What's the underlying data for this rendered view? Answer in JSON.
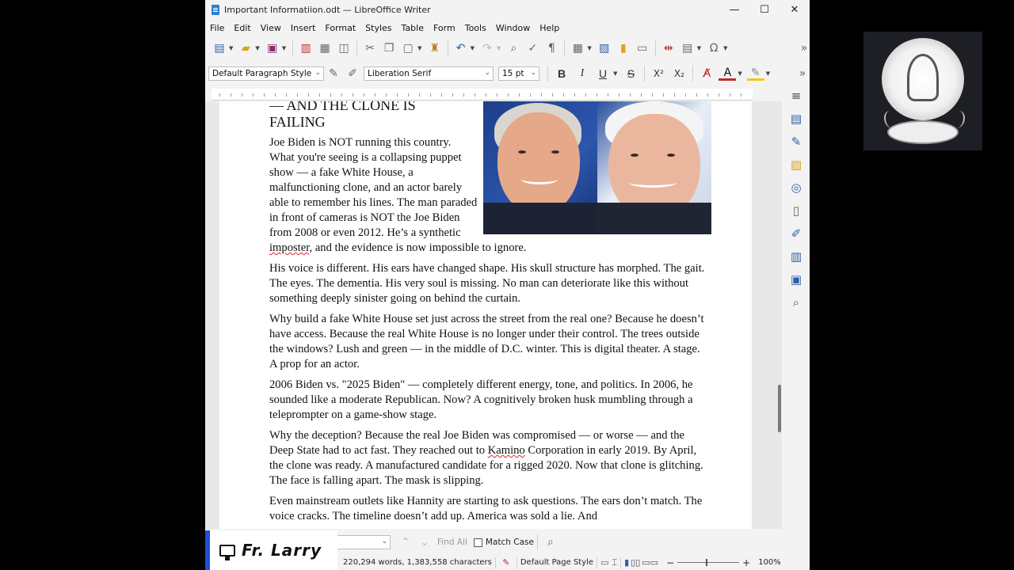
{
  "window": {
    "title": "Important Informatiion.odt — LibreOffice Writer",
    "minimize": "—",
    "maximize": "☐",
    "close": "✕"
  },
  "menu": [
    "File",
    "Edit",
    "View",
    "Insert",
    "Format",
    "Styles",
    "Table",
    "Form",
    "Tools",
    "Window",
    "Help"
  ],
  "formatting": {
    "paragraph_style": "Default Paragraph Style",
    "font_name": "Liberation Serif",
    "font_size": "15 pt",
    "bold": "B",
    "italic": "I",
    "underline": "U",
    "strike": "S",
    "superscript": "X²",
    "subscript": "X₂",
    "more": "»"
  },
  "document": {
    "heading_line1": "— AND THE CLONE IS",
    "heading_line2": "FAILING",
    "p1a": "Joe Biden is NOT running this country. What you're seeing is a collapsing puppet show — a fake White House, a malfunctioning clone, and an actor barely able to remember his lines. The man paraded in front of cameras is NOT the Joe Biden from 2008 or even 2012. He’s a synthetic ",
    "p1_misspelled": "imposter",
    "p1b": ", and the evidence is now impossible to ignore.",
    "p2": "His voice is different. His ears have changed shape. His skull structure has morphed. The gait. The eyes. The dementia. His very soul is missing. No man can deteriorate like this without something deeply sinister going on behind the curtain.",
    "p3": "Why build a fake White House set just across the street from the real one? Because he doesn’t have access. Because the real White House is no longer under their control. The trees outside the windows? Lush and green — in the middle of D.C. winter. This is digital theater. A stage. A prop for an actor.",
    "p4": "2006 Biden vs. \"2025 Biden\" — completely different energy, tone, and politics. In 2006, he sounded like a moderate Republican. Now? A cognitively broken husk mumbling through a teleprompter on a game-show stage.",
    "p5a": "Why the deception? Because the real Joe Biden was compromised — or worse — and the Deep State had to act fast. They reached out to ",
    "p5_misspelled": "Kamino",
    "p5b": " Corporation in early 2019. By April, the clone was ready. A manufactured candidate for a rigged 2020. Now that clone is glitching. The face is falling apart. The mask is slipping.",
    "p6": "Even mainstream outlets like Hannity are starting to ask questions. The ears don’t match. The voice cracks. The timeline doesn’t add up. America was sold a lie. And"
  },
  "findbar": {
    "find_all": "Find All",
    "match_case": "Match Case"
  },
  "status": {
    "word_count": "220,294 words, 1,383,558 characters",
    "page_style": "Default Page Style",
    "zoom": "100%",
    "zoom_minus": "−",
    "zoom_plus": "+"
  },
  "overlay": {
    "brand": "Fr. Larry"
  },
  "colors": {
    "accent": "#2f5fa8",
    "overlay_border": "#1f4fd6",
    "font_color": "#c02a2a",
    "highlight": "#f5c518"
  }
}
